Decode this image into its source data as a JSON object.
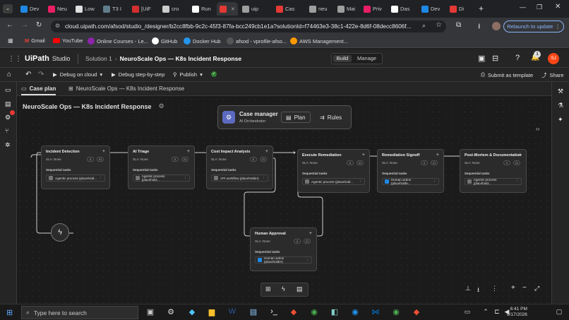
{
  "browser": {
    "tabs": [
      {
        "label": "Dev",
        "color": "#1e88e5"
      },
      {
        "label": "Neu",
        "color": "#e91e63"
      },
      {
        "label": "Low",
        "color": "#e0e0e0"
      },
      {
        "label": "T3 I",
        "color": "#607d8b"
      },
      {
        "label": "[UiF",
        "color": "#d32f2f"
      },
      {
        "label": "cro",
        "color": "#cccccc"
      },
      {
        "label": "Run",
        "color": "#ffffff"
      },
      {
        "label": "",
        "color": "#e53935"
      },
      {
        "label": "uip",
        "color": "#9e9e9e"
      },
      {
        "label": "Cas",
        "color": "#e53935"
      },
      {
        "label": "neu",
        "color": "#9e9e9e"
      },
      {
        "label": "Mai",
        "color": "#9e9e9e"
      },
      {
        "label": "Priv",
        "color": "#e91e63"
      },
      {
        "label": "Das",
        "color": "#ffffff"
      },
      {
        "label": "Dev",
        "color": "#1e88e5"
      },
      {
        "label": "Di",
        "color": "#e53935"
      }
    ],
    "url": "cloud.uipath.com/afsod/studio_/designer/b2cc8fbb-9c2c-45f3-87fa-bcc249cb1e1a?solutionId=f74463e3-38c1-422e-8d6f-08decc8606f...",
    "relaunch_label": "Relaunch to update",
    "bookmarks": [
      "Gmail",
      "YouTube",
      "Online Courses - Le...",
      "GitHub",
      "Docker Hub",
      "afsod - vprofile-afso...",
      "AWS Management..."
    ]
  },
  "app": {
    "logo": "UiPath",
    "product": "Studio",
    "breadcrumb_solution": "Solution 1",
    "breadcrumb_project": "NeuroScale Ops — K8s Incident Response",
    "build_label": "Build",
    "manage_label": "Manage",
    "notification_count": "1",
    "avatar_initials": "SJ",
    "brand_color": "#fa4616"
  },
  "toolbar": {
    "debug_cloud": "Debug on cloud",
    "debug_step": "Debug step-by-step",
    "publish": "Publish",
    "submit_template": "Submit as template",
    "share": "Share"
  },
  "tabs": {
    "case_plan": "Case plan",
    "project_tab": "NeuroScale Ops — K8s Incident Response"
  },
  "canvas": {
    "title": "NeuroScale Ops — K8s Incident Response",
    "case_manager": {
      "title": "Case manager",
      "subtitle": "AI Orchestrator",
      "plan": "Plan",
      "rules": "Rules"
    },
    "stages": [
      {
        "title": "Incident Detection",
        "sla": "SLA: None",
        "seq": "Sequential tasks",
        "task": "Agentic process (placehold...",
        "c1": "0",
        "c2": "21"
      },
      {
        "title": "AI Triage",
        "sla": "SLA: None",
        "seq": "Sequential tasks",
        "task": "Agentic process (placehold...",
        "c1": "0",
        "c2": "21"
      },
      {
        "title": "Cost Impact Analysis",
        "sla": "SLA: None",
        "seq": "Sequential tasks",
        "task": "API workflow (placeholder)",
        "c1": "0",
        "c2": "21"
      },
      {
        "title": "Execute Remediation",
        "sla": "SLA: None",
        "seq": "Sequential tasks",
        "task": "Agentic process (placehold...",
        "c1": "0",
        "c2": "21"
      },
      {
        "title": "Remediation Signoff",
        "sla": "SLA: None",
        "seq": "Sequential tasks",
        "task": "Human action (placeholde...",
        "c1": "0",
        "c2": "21"
      },
      {
        "title": "Post-Mortem & Documentation",
        "sla": "SLA: None",
        "seq": "Sequential tasks",
        "task": "Agentic process (placehold...",
        "c1": "0",
        "c2": "21"
      },
      {
        "title": "Human Approval",
        "sla": "SLA: None",
        "seq": "Sequential tasks",
        "task": "Human action (placeholder)",
        "c1": "0",
        "c2": "21"
      }
    ]
  },
  "taskbar": {
    "search_placeholder": "Type here to search",
    "time": "6:41 PM",
    "date": "6/17/2026"
  }
}
